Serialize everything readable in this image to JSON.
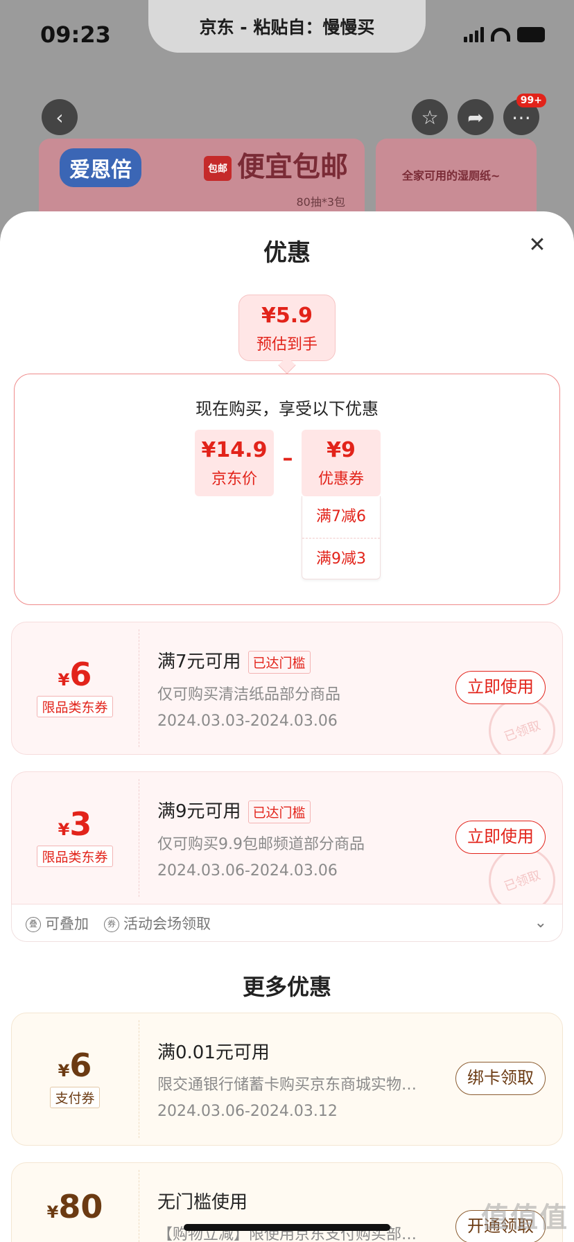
{
  "status_bar": {
    "time": "09:23"
  },
  "paste_toast": {
    "text": "京东 - 粘贴自：慢慢买"
  },
  "background": {
    "badge": "99+",
    "banner_logo": "爱恩倍",
    "banner_mail_icon": "包邮",
    "banner_title": "便宜包邮",
    "banner_sub": "80抽*3包",
    "banner2_text": "全家可用的湿厕纸~"
  },
  "sheet": {
    "title": "优惠",
    "estimate": {
      "price": "¥5.9",
      "label": "预估到手"
    },
    "calc": {
      "title": "现在购买，享受以下优惠",
      "jd_price": {
        "value": "¥14.9",
        "label": "京东价"
      },
      "minus": "–",
      "coupon": {
        "value": "¥9",
        "label": "优惠券"
      },
      "coupon_breakdown": [
        "满7减6",
        "满9减3"
      ]
    },
    "coupons": [
      {
        "currency": "¥",
        "amount": "6",
        "type": "限品类东券",
        "condition": "满7元可用",
        "reached": "已达门槛",
        "desc": "仅可购买清洁纸品部分商品",
        "date": "2024.03.03-2024.03.06",
        "button": "立即使用",
        "stamp": "已领取"
      },
      {
        "currency": "¥",
        "amount": "3",
        "type": "限品类东券",
        "condition": "满9元可用",
        "reached": "已达门槛",
        "desc": "仅可购买9.9包邮频道部分商品",
        "date": "2024.03.06-2024.03.06",
        "button": "立即使用",
        "stamp": "已领取"
      }
    ],
    "extras": {
      "stackable": "可叠加",
      "venue": "活动会场领取"
    },
    "more_title": "更多优惠",
    "more_coupons": [
      {
        "currency": "¥",
        "amount": "6",
        "type": "支付券",
        "condition": "满0.01元可用",
        "desc": "限交通银行储蓄卡购买京东商城实物…",
        "date": "2024.03.06-2024.03.12",
        "button": "绑卡领取"
      },
      {
        "currency": "¥",
        "amount": "80",
        "condition": "无门槛使用",
        "desc": "【购物立减】限使用京东支付购买部…",
        "button": "开通领取"
      }
    ]
  },
  "watermark": "值值值"
}
